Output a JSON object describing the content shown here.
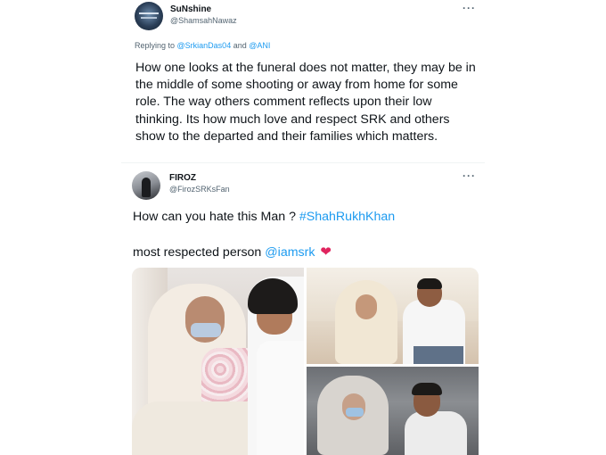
{
  "tweet1": {
    "display_name": "SuNshine",
    "handle": "@ShamsahNawaz",
    "reply_prefix": "Replying to ",
    "reply_user1": "@SrkianDas04",
    "reply_and": " and ",
    "reply_user2": "@ANI",
    "body": "How one looks at the funeral does not matter, they may be in the middle of some shooting or away from home for some role. The way others comment reflects upon their low thinking. Its how much love and respect SRK and others show to the departed and their families which matters.",
    "more_icon": "···"
  },
  "tweet2": {
    "display_name": "FIROZ",
    "handle": "@FirozSRKsFan",
    "line1_text": "How can you hate this Man ? ",
    "line1_hashtag": "#ShahRukhKhan",
    "line2_text": "most respected person ",
    "line2_mention": "@iamsrk",
    "heart": "❤",
    "more_icon": "···",
    "photos": [
      "photo-1",
      "photo-2",
      "photo-3"
    ]
  },
  "colors": {
    "link": "#1d9bf0",
    "secondary_text": "#536471",
    "primary_text": "#0f1419",
    "heart": "#e0245e"
  }
}
